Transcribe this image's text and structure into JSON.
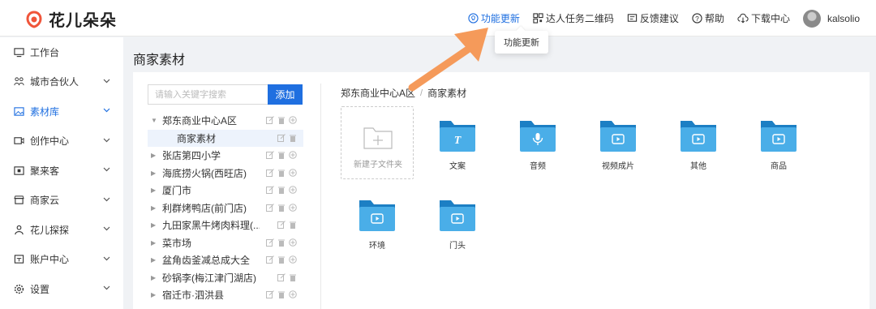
{
  "app": {
    "name": "花儿朵朵"
  },
  "colors": {
    "accent": "#1f6fe0",
    "brand": "#f0553a",
    "folder": "#4aaee8",
    "folder_dark": "#1c7fc4",
    "arrow": "#f59a5a"
  },
  "topnav": {
    "items": [
      {
        "label": "功能更新",
        "icon": "bulb-icon",
        "active": true
      },
      {
        "label": "达人任务二维码",
        "icon": "qrcode-icon",
        "active": false
      },
      {
        "label": "反馈建议",
        "icon": "feedback-icon",
        "active": false
      },
      {
        "label": "帮助",
        "icon": "help-icon",
        "active": false
      },
      {
        "label": "下载中心",
        "icon": "cloud-download-icon",
        "active": false
      }
    ],
    "username": "kalsolio"
  },
  "tooltip": {
    "text": "功能更新"
  },
  "sidebar": {
    "items": [
      {
        "label": "工作台",
        "icon": "monitor-icon",
        "expandable": false,
        "active": false
      },
      {
        "label": "城市合伙人",
        "icon": "partner-icon",
        "expandable": true,
        "active": false
      },
      {
        "label": "素材库",
        "icon": "image-icon",
        "expandable": true,
        "active": true
      },
      {
        "label": "创作中心",
        "icon": "video-icon",
        "expandable": true,
        "active": false
      },
      {
        "label": "聚来客",
        "icon": "scan-icon",
        "expandable": true,
        "active": false
      },
      {
        "label": "商家云",
        "icon": "store-icon",
        "expandable": true,
        "active": false
      },
      {
        "label": "花儿探探",
        "icon": "people-icon",
        "expandable": true,
        "active": false
      },
      {
        "label": "账户中心",
        "icon": "account-icon",
        "expandable": true,
        "active": false
      },
      {
        "label": "设置",
        "icon": "gear-icon",
        "expandable": true,
        "active": false
      }
    ]
  },
  "main": {
    "page_title": "商家素材",
    "search": {
      "placeholder": "请输入关键字搜索",
      "value": ""
    },
    "add_button": "添加",
    "tree": [
      {
        "label": "郑东商业中心A区",
        "expanded": true,
        "child": false,
        "selected": false
      },
      {
        "label": "商家素材",
        "expanded": false,
        "child": true,
        "selected": true
      },
      {
        "label": "张店第四小学",
        "expanded": false,
        "child": false,
        "selected": false
      },
      {
        "label": "海底捞火锅(西旺店)",
        "expanded": false,
        "child": false,
        "selected": false
      },
      {
        "label": "厦门市",
        "expanded": false,
        "child": false,
        "selected": false
      },
      {
        "label": "利群烤鸭店(前门店)",
        "expanded": false,
        "child": false,
        "selected": false
      },
      {
        "label": "九田家黑牛烤肉料理(...",
        "expanded": false,
        "child": false,
        "selected": false
      },
      {
        "label": "菜市场",
        "expanded": false,
        "child": false,
        "selected": false
      },
      {
        "label": "盆角齿釜减总成大全",
        "expanded": false,
        "child": false,
        "selected": false
      },
      {
        "label": "砂锅李(梅江津门湖店)",
        "expanded": false,
        "child": false,
        "selected": false
      },
      {
        "label": "宿迁市·泗洪县",
        "expanded": false,
        "child": false,
        "selected": false
      }
    ],
    "breadcrumb": [
      "郑东商业中心A区",
      "商家素材"
    ],
    "breadcrumb_sep": "/",
    "new_folder_label": "新建子文件夹",
    "folders": [
      {
        "label": "文案",
        "icon": "text-icon"
      },
      {
        "label": "音频",
        "icon": "microphone-icon"
      },
      {
        "label": "视频成片",
        "icon": "play-icon"
      },
      {
        "label": "其他",
        "icon": "play-icon"
      },
      {
        "label": "商品",
        "icon": "play-icon"
      },
      {
        "label": "环境",
        "icon": "play-icon"
      },
      {
        "label": "门头",
        "icon": "play-icon"
      }
    ]
  }
}
